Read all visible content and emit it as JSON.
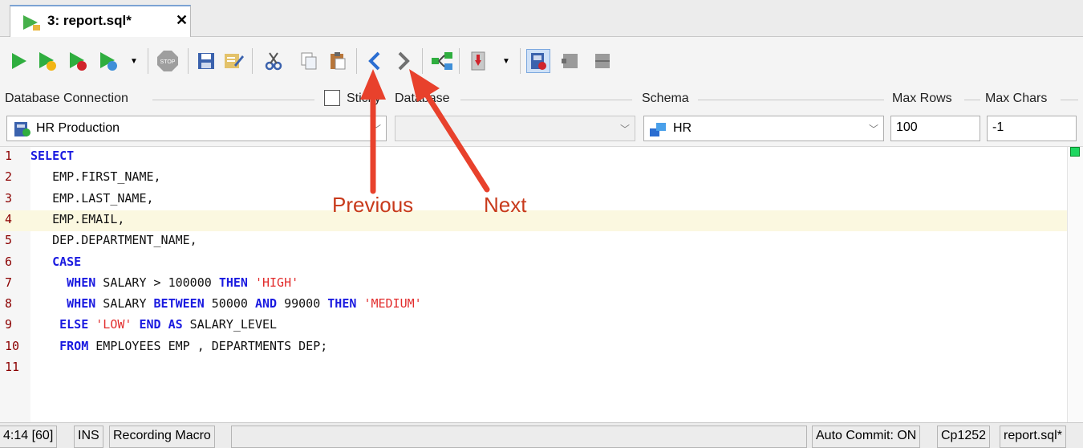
{
  "tab": {
    "label": "3: report.sql*",
    "close": "✕"
  },
  "toolbar": {
    "buttons": [
      "run-icon",
      "run-current-icon",
      "stop-run-icon",
      "explain-plan-icon",
      "stop-icon",
      "save-icon",
      "edit-icon",
      "cut-icon",
      "copy-icon",
      "paste-icon",
      "previous-icon",
      "next-icon",
      "query-builder-icon",
      "export-icon",
      "layout-icon",
      "panel-icon",
      "panel-icon-2"
    ]
  },
  "connection": {
    "db_connection_label": "Database Connection",
    "db_connection_value": "HR Production",
    "sticky_label": "Sticky",
    "database_label": "Database",
    "database_value": "",
    "schema_label": "Schema",
    "schema_value": "HR",
    "max_rows_label": "Max Rows",
    "max_rows_value": "100",
    "max_chars_label": "Max Chars",
    "max_chars_value": "-1"
  },
  "editor": {
    "line_numbers": [
      "1",
      "2",
      "3",
      "4",
      "5",
      "6",
      "7",
      "8",
      "9",
      "10",
      "11"
    ],
    "current_line": 4
  },
  "annotations": {
    "previous": "Previous",
    "next": "Next",
    "arrow_color": "#e8412c"
  },
  "status": {
    "position": "4:14 [60]",
    "mode": "INS",
    "macro": "Recording Macro",
    "autocommit": "Auto Commit: ON",
    "encoding": "Cp1252",
    "file": "report.sql*"
  }
}
